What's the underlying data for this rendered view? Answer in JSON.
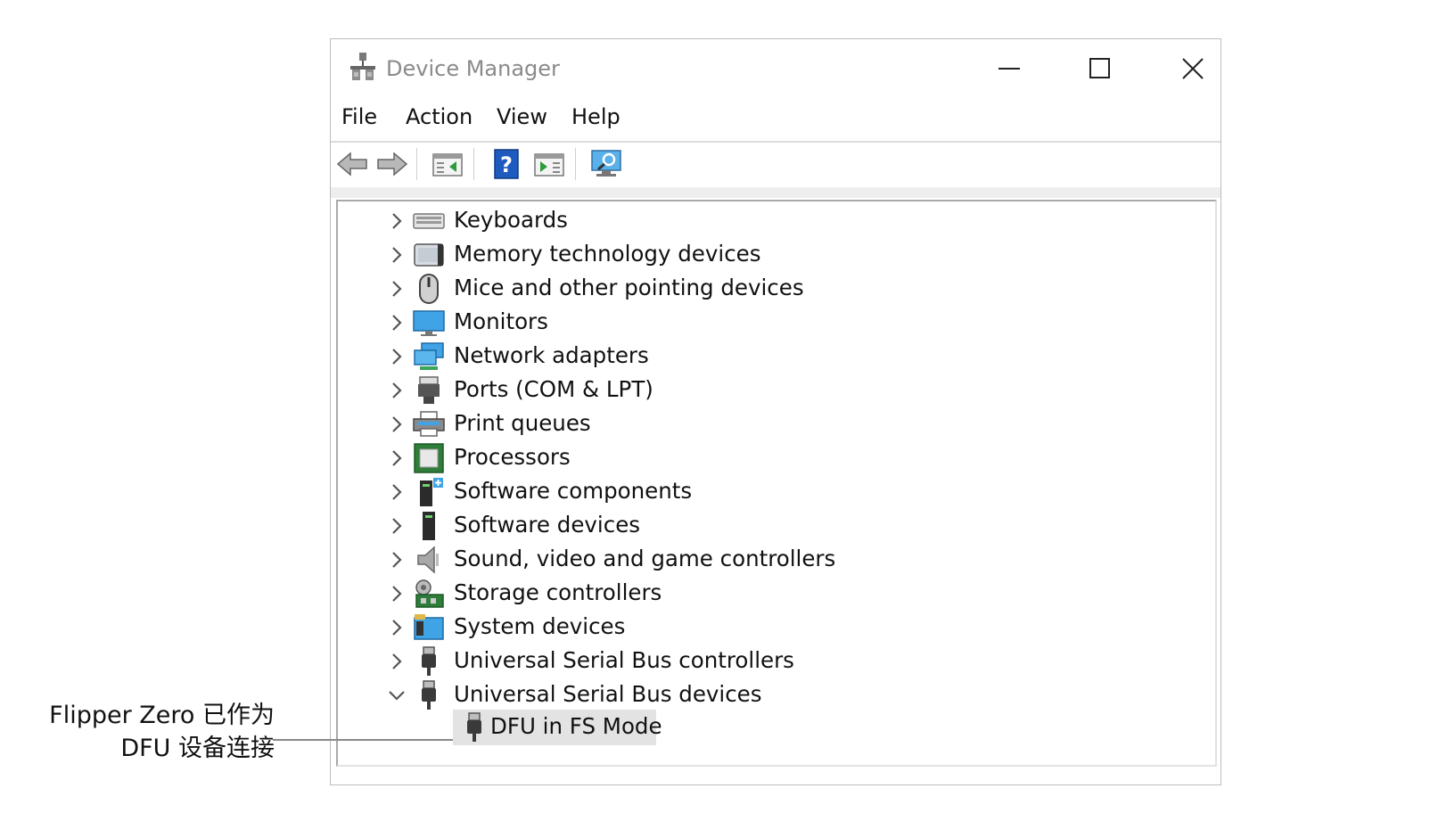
{
  "window": {
    "title": "Device Manager",
    "controls": {
      "minimize": "minimize-icon",
      "maximize": "maximize-icon",
      "close": "close-icon"
    }
  },
  "menu": [
    "File",
    "Action",
    "View",
    "Help"
  ],
  "toolbar": {
    "buttons": [
      "back-arrow-icon",
      "forward-arrow-icon",
      "properties-icon",
      "help-icon",
      "update-driver-icon",
      "scan-hardware-icon"
    ]
  },
  "tree": {
    "items": [
      {
        "label": "Keyboards",
        "icon": "keyboard-icon",
        "expanded": false
      },
      {
        "label": "Memory technology devices",
        "icon": "memory-device-icon",
        "expanded": false
      },
      {
        "label": "Mice and other pointing devices",
        "icon": "mouse-icon",
        "expanded": false
      },
      {
        "label": "Monitors",
        "icon": "monitor-icon",
        "expanded": false
      },
      {
        "label": "Network adapters",
        "icon": "network-adapter-icon",
        "expanded": false
      },
      {
        "label": "Ports (COM & LPT)",
        "icon": "port-icon",
        "expanded": false
      },
      {
        "label": "Print queues",
        "icon": "printer-icon",
        "expanded": false
      },
      {
        "label": "Processors",
        "icon": "processor-icon",
        "expanded": false
      },
      {
        "label": "Software components",
        "icon": "software-component-icon",
        "expanded": false
      },
      {
        "label": "Software devices",
        "icon": "software-device-icon",
        "expanded": false
      },
      {
        "label": "Sound, video and game controllers",
        "icon": "speaker-icon",
        "expanded": false
      },
      {
        "label": "Storage controllers",
        "icon": "storage-controller-icon",
        "expanded": false
      },
      {
        "label": "System devices",
        "icon": "system-device-icon",
        "expanded": false
      },
      {
        "label": "Universal Serial Bus controllers",
        "icon": "usb-icon",
        "expanded": false
      },
      {
        "label": "Universal Serial Bus devices",
        "icon": "usb-icon",
        "expanded": true
      }
    ],
    "selected_child": {
      "label": "DFU in FS Mode",
      "icon": "usb-icon"
    }
  },
  "callout": {
    "line1": "Flipper Zero 已作为",
    "line2": "DFU 设备连接"
  },
  "colors": {
    "selection": "#e3e3e3",
    "title_text": "#8a8a8a",
    "accent_blue": "#1e73d0"
  }
}
